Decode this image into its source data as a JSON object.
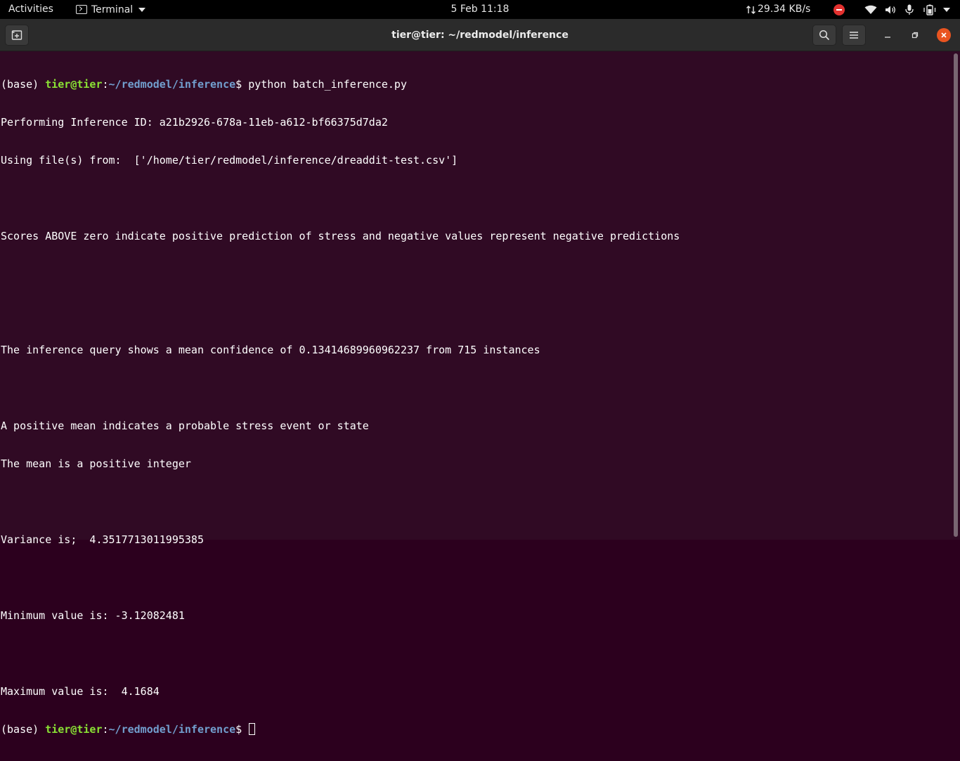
{
  "topbar": {
    "activities": "Activities",
    "app_menu": "Terminal",
    "clock": "5 Feb  11:18",
    "net_speed": "29.34 KB/s",
    "icons": [
      "network-transfer-icon",
      "do-not-disturb-icon",
      "wifi-icon",
      "volume-icon",
      "microphone-icon",
      "battery-icon",
      "system-menu-caret-icon"
    ]
  },
  "window": {
    "title": "tier@tier: ~/redmodel/inference",
    "buttons": [
      "new-tab",
      "search",
      "menu",
      "minimize",
      "maximize",
      "close"
    ]
  },
  "terminal": {
    "prompt": {
      "env": "(base) ",
      "user_host": "tier@tier",
      "sep": ":",
      "path": "~/redmodel/inference",
      "dollar": "$ "
    },
    "command": "python batch_inference.py",
    "lines": [
      "Performing Inference ID: a21b2926-678a-11eb-a612-bf66375d7da2",
      "Using file(s) from:  ['/home/tier/redmodel/inference/dreaddit-test.csv']",
      "",
      "Scores ABOVE zero indicate positive prediction of stress and negative values represent negative predictions",
      "",
      "",
      "The inference query shows a mean confidence of 0.13414689960962237 from 715 instances",
      "",
      "A positive mean indicates a probable stress event or state",
      "The mean is a positive integer",
      "",
      "Variance is;  4.3517713011995385",
      "",
      "Minimum value is: -3.12082481",
      "",
      "Maximum value is:  4.1684"
    ]
  },
  "colors": {
    "terminal_bg": "#300a24",
    "prompt_user": "#8ae234",
    "prompt_path": "#729fcf",
    "close_button": "#e95420"
  }
}
